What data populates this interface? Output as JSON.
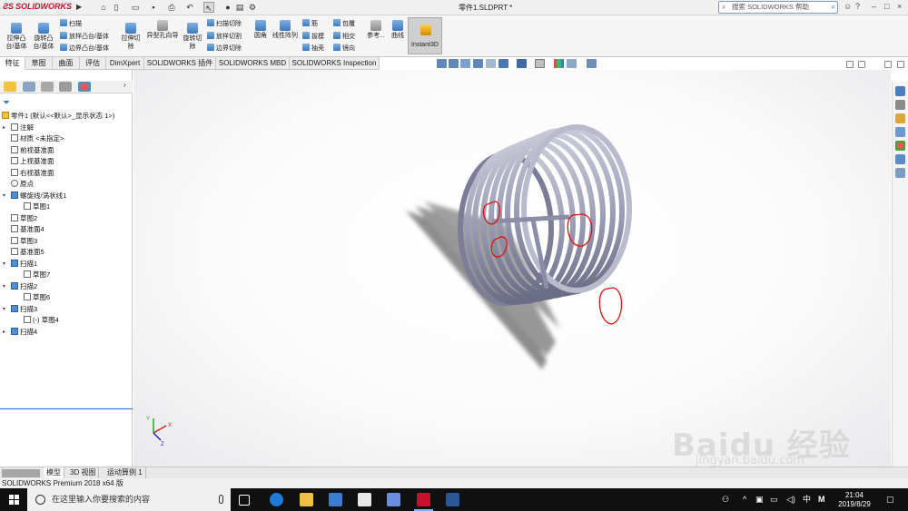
{
  "app": {
    "logo": "SOLIDWORKS",
    "document_title": "零件1.SLDPRT *",
    "search_placeholder": "搜索 SOLIDWORKS 帮助"
  },
  "ribbon": {
    "extrude_boss": "拉伸凸\n台/基体",
    "revolve_boss": "旋转凸\n台/基体",
    "sweep": "扫描",
    "loft_boss": "放样凸台/基体",
    "boundary_boss": "边界凸台/基体",
    "extrude_cut": "拉伸切\n除",
    "hole_wizard": "异型孔向导",
    "revolve_cut": "旋转切\n除",
    "sweep_cut": "扫描切除",
    "loft_cut": "放样切割",
    "boundary_cut": "边界切除",
    "fillet": "圆角",
    "linear_pattern": "线性阵列",
    "rib": "筋",
    "draft": "拔模",
    "shell": "抽壳",
    "wrap": "包覆",
    "intersect": "相交",
    "mirror": "镜向",
    "reference": "参考...",
    "curves": "曲线",
    "instant3d": "Instant3D"
  },
  "tabs": [
    "特征",
    "草图",
    "曲面",
    "评估",
    "DimXpert",
    "SOLIDWORKS 插件",
    "SOLIDWORKS MBD",
    "SOLIDWORKS Inspection"
  ],
  "tree": {
    "root": "零件1  (默认<<默认>_显示状态 1>)",
    "items": [
      "注解",
      "材质 <未指定>",
      "前视基准面",
      "上视基准面",
      "右视基准面",
      "原点",
      "螺旋线/涡状线1",
      "草图1",
      "草图2",
      "基准面4",
      "草图3",
      "基准面5",
      "扫描1",
      "草图7",
      "扫描2",
      "草图6",
      "扫描3",
      "(-) 草图4",
      "扫描4"
    ]
  },
  "bottom_tabs": [
    "模型",
    "3D 视图",
    "运动算例 1"
  ],
  "status": "SOLIDWORKS Premium 2018 x64 版",
  "taskbar": {
    "search_placeholder": "在这里输入你要搜索的内容",
    "ime": "中",
    "clock_time": "21:04",
    "clock_date": "2019/8/29"
  },
  "watermark": {
    "brand": "Baidu 经验",
    "url": "jingyan.baidu.com"
  }
}
